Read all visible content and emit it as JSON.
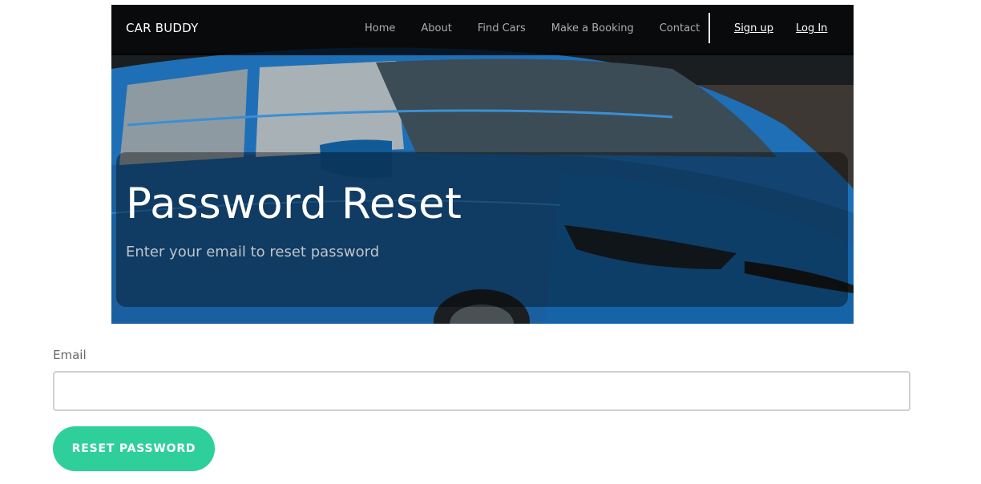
{
  "navbar": {
    "brand": "CAR BUDDY",
    "links": [
      "Home",
      "About",
      "Find Cars",
      "Make a Booking",
      "Contact"
    ],
    "signup_label": "Sign up",
    "login_label": "Log In"
  },
  "hero": {
    "title": "Password Reset",
    "subtitle": "Enter your email to reset password"
  },
  "form": {
    "email_label": "Email",
    "email_value": "",
    "submit_label": "RESET PASSWORD"
  },
  "colors": {
    "accent": "#2fcf9c",
    "navbar_bg": "#000000",
    "car_blue": "#1a6fb5"
  }
}
